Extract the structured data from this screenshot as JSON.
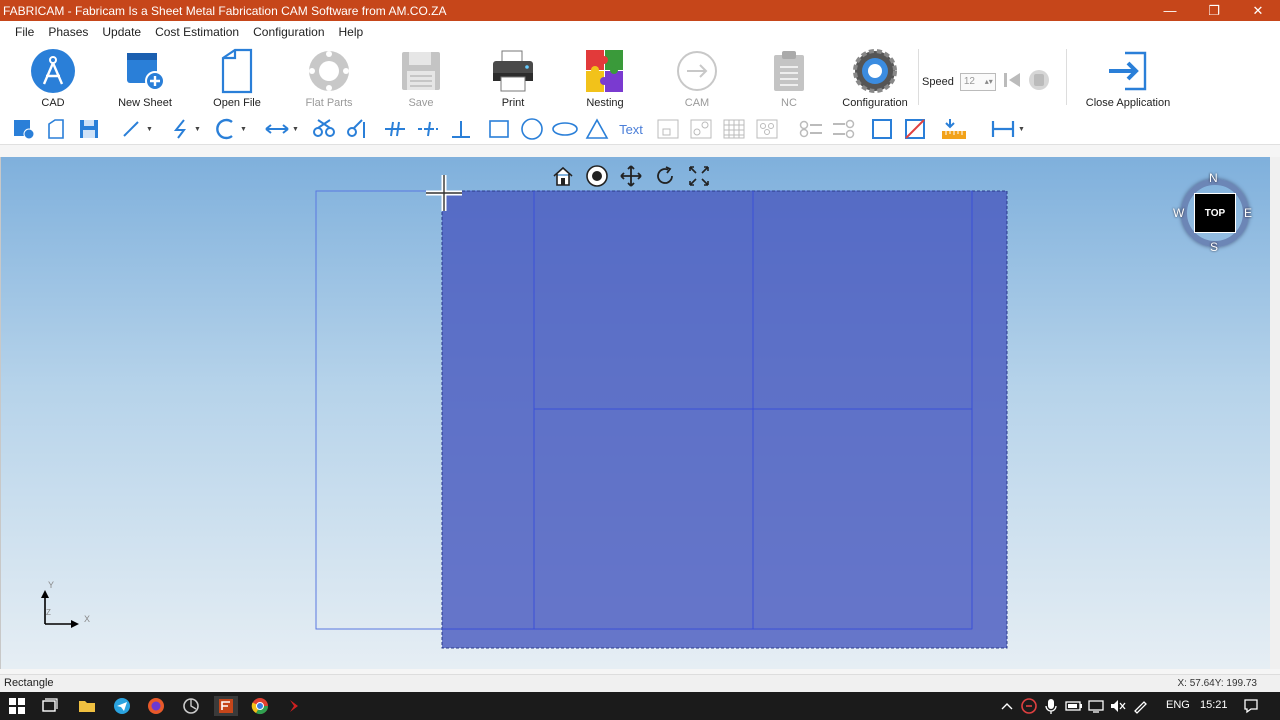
{
  "window": {
    "title": "FABRICAM - Fabricam Is a Sheet Metal Fabrication CAM Software from AM.CO.ZA",
    "minimize": "—",
    "restore": "❐",
    "close": "✕"
  },
  "menu": [
    "File",
    "Phases",
    "Update",
    "Cost Estimation",
    "Configuration",
    "Help"
  ],
  "ribbon": {
    "cad": "CAD",
    "new_sheet": "New Sheet",
    "open_file": "Open File",
    "flat_parts": "Flat Parts",
    "save": "Save",
    "print": "Print",
    "nesting": "Nesting",
    "cam": "CAM",
    "nc": "NC",
    "configuration": "Configuration",
    "speed_label": "Speed",
    "speed_value": "12",
    "close_application": "Close Application"
  },
  "toolbar": {
    "text_tool": "Text"
  },
  "compass": {
    "n": "N",
    "s": "S",
    "e": "E",
    "w": "W",
    "view": "TOP"
  },
  "axes": {
    "x": "X",
    "y": "Y",
    "z": "Z"
  },
  "status": {
    "left": "Rectangle",
    "coords": "X: 57.64Y: 199.73"
  },
  "taskbar": {
    "language": "ENG",
    "time": "15:21"
  },
  "colors": {
    "titlebar": "#c6461a",
    "accent_blue": "#2a7fd8",
    "selection_fill": "#5566c0"
  }
}
